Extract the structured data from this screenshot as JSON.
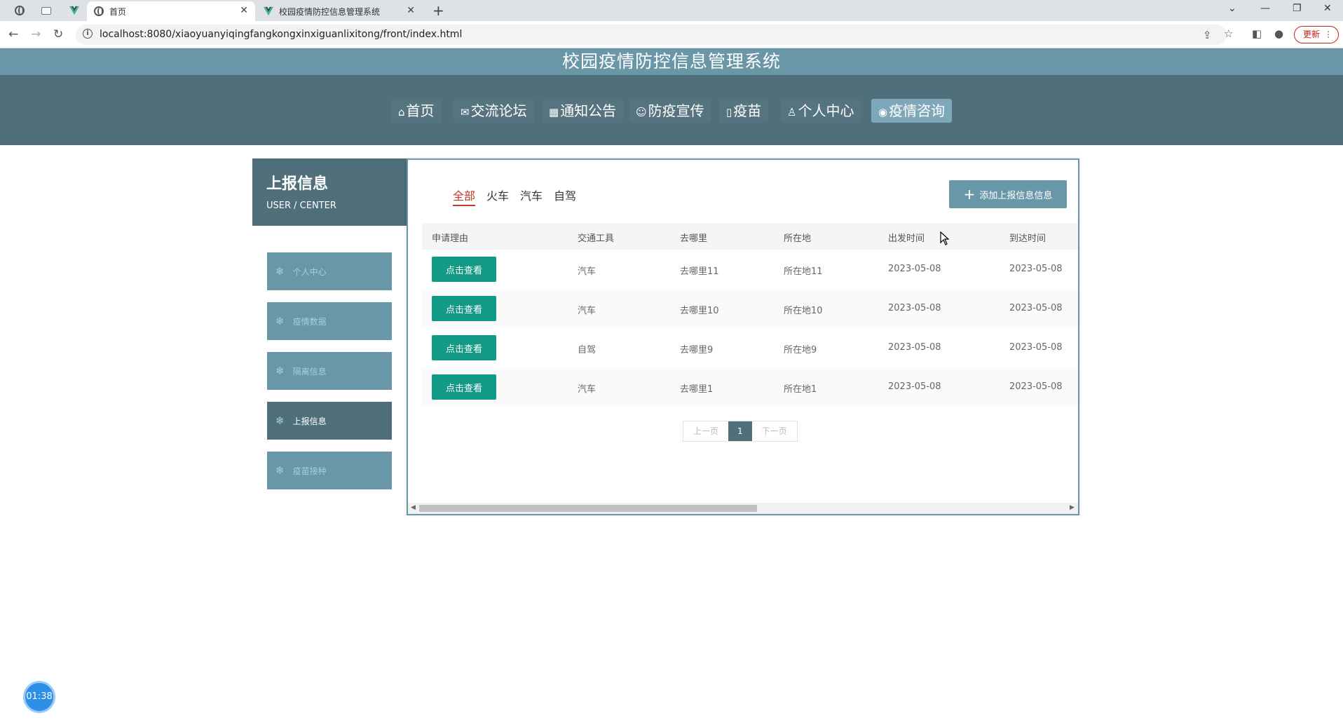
{
  "browser": {
    "tabs": [
      {
        "title": "首页",
        "active": true
      },
      {
        "title": "校园疫情防控信息管理系统",
        "active": false
      }
    ],
    "url": "localhost:8080/xiaoyuanyiqingfangkongxinxiguanlixitong/front/index.html",
    "update_label": "更新"
  },
  "site": {
    "title": "校园疫情防控信息管理系统",
    "nav": [
      {
        "label": "首页",
        "icon": "home-icon"
      },
      {
        "label": "交流论坛",
        "icon": "mail-icon"
      },
      {
        "label": "通知公告",
        "icon": "calendar-icon"
      },
      {
        "label": "防疫宣传",
        "icon": "smile-icon"
      },
      {
        "label": "疫苗",
        "icon": "document-icon"
      },
      {
        "label": "个人中心",
        "icon": "user-icon"
      },
      {
        "label": "疫情咨询",
        "icon": "chat-icon"
      }
    ]
  },
  "sidebar": {
    "title": "上报信息",
    "subtitle": "USER / CENTER",
    "items": [
      {
        "label": "个人中心"
      },
      {
        "label": "疫情数据"
      },
      {
        "label": "隔离信息"
      },
      {
        "label": "上报信息",
        "active": true
      },
      {
        "label": "疫苗接种"
      }
    ]
  },
  "main": {
    "filters": [
      "全部",
      "火车",
      "汽车",
      "自驾"
    ],
    "active_filter": "全部",
    "add_button": "添加上报信息信息",
    "table": {
      "headers": [
        "申请理由",
        "交通工具",
        "去哪里",
        "所在地",
        "出发时间",
        "到达时间"
      ],
      "view_label": "点击查看",
      "rows": [
        {
          "transport": "汽车",
          "destination": "去哪里11",
          "location": "所在地11",
          "depart": "2023-05-08",
          "arrive": "2023-05-08"
        },
        {
          "transport": "汽车",
          "destination": "去哪里10",
          "location": "所在地10",
          "depart": "2023-05-08",
          "arrive": "2023-05-08"
        },
        {
          "transport": "自驾",
          "destination": "去哪里9",
          "location": "所在地9",
          "depart": "2023-05-08",
          "arrive": "2023-05-08"
        },
        {
          "transport": "汽车",
          "destination": "去哪里1",
          "location": "所在地1",
          "depart": "2023-05-08",
          "arrive": "2023-05-08"
        }
      ]
    },
    "pagination": {
      "prev": "上一页",
      "current": "1",
      "next": "下一页"
    }
  },
  "timer": "01:38",
  "colors": {
    "header_dark": "#4f6f7b",
    "header_light": "#6a97a8",
    "view_button": "#139a87",
    "active_filter": "#c0392b"
  }
}
